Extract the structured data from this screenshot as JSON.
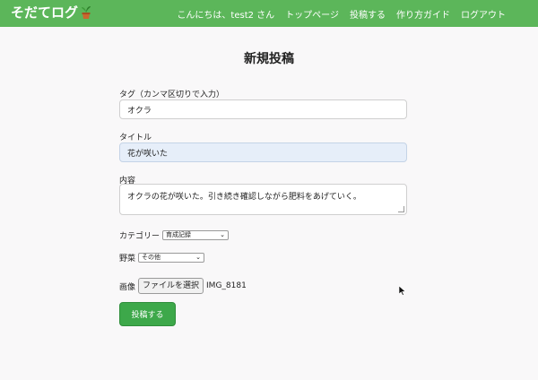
{
  "header": {
    "brand": "そだてログ",
    "greeting": "こんにちは、test2 さん",
    "nav": [
      "トップページ",
      "投稿する",
      "作り方ガイド",
      "ログアウト"
    ]
  },
  "page": {
    "title": "新規投稿"
  },
  "form": {
    "tags_label": "タグ（カンマ区切りで入力）",
    "tags_value": "オクラ",
    "title_label": "タイトル",
    "title_value": "花が咲いた",
    "content_label": "内容",
    "content_value": "オクラの花が咲いた。引き続き確認しながら肥料をあげていく。",
    "category_label": "カテゴリー",
    "category_value": "育成記録",
    "vegetable_label": "野菜",
    "vegetable_value": "その他",
    "image_label": "画像",
    "file_button_label": "ファイルを選択",
    "file_name": "IMG_8181",
    "submit_label": "投稿する"
  },
  "colors": {
    "header": "#5cb65a",
    "submit": "#3da84a",
    "filled_input": "#e6eef9"
  },
  "icons": {
    "brand": "potted-plant-icon",
    "cursor": "mouse-pointer-icon"
  }
}
